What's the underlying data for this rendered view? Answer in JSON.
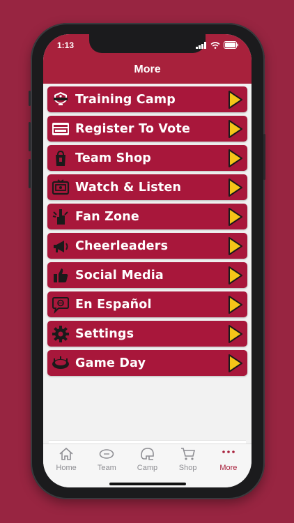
{
  "status": {
    "time": "1:13"
  },
  "header": {
    "title": "More"
  },
  "menu": [
    {
      "label": "Training Camp",
      "icon": "training-camp-logo-icon"
    },
    {
      "label": "Register To Vote",
      "icon": "arizona-votes-icon"
    },
    {
      "label": "Team Shop",
      "icon": "shopping-bag-icon"
    },
    {
      "label": "Watch & Listen",
      "icon": "radio-tv-icon"
    },
    {
      "label": "Fan Zone",
      "icon": "foam-finger-icon"
    },
    {
      "label": "Cheerleaders",
      "icon": "megaphone-icon"
    },
    {
      "label": "Social Media",
      "icon": "thumbs-up-icon"
    },
    {
      "label": "En Español",
      "icon": "speech-bubble-icon"
    },
    {
      "label": "Settings",
      "icon": "gear-icon"
    },
    {
      "label": "Game Day",
      "icon": "stadium-icon"
    }
  ],
  "tabs": [
    {
      "label": "Home",
      "icon": "home-icon",
      "active": false
    },
    {
      "label": "Team",
      "icon": "football-icon",
      "active": false
    },
    {
      "label": "Camp",
      "icon": "helmet-icon",
      "active": false
    },
    {
      "label": "Shop",
      "icon": "cart-icon",
      "active": false
    },
    {
      "label": "More",
      "icon": "more-dots-icon",
      "active": true
    }
  ],
  "colors": {
    "background": "#982541",
    "header": "#a8213c",
    "menu_item": "#a8173b",
    "arrow": "#f5c518",
    "tab_active": "#a8213c",
    "tab_inactive": "#8e8e93"
  }
}
